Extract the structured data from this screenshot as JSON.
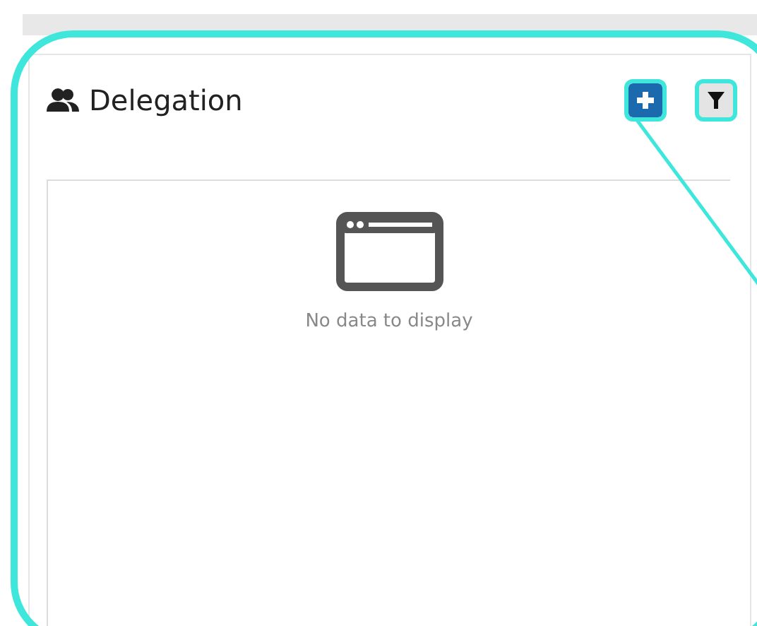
{
  "panel": {
    "title": "Delegation",
    "buttons": [
      {
        "kind": "add",
        "highlighted": true
      },
      {
        "kind": "filter",
        "highlighted": true
      }
    ],
    "empty_state": {
      "message": "No data to display"
    }
  },
  "tutorial_highlight": {
    "visible": true
  }
}
